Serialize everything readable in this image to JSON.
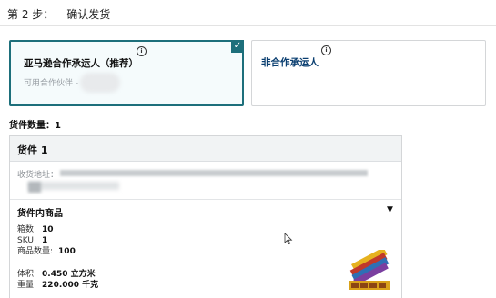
{
  "step": {
    "label": "第 2 步：",
    "title": "确认发货"
  },
  "carriers": [
    {
      "name": "亚马逊合作承运人（推荐）",
      "partner_label": "可用合作伙伴 -",
      "selected": true
    },
    {
      "name": "非合作承运人",
      "selected": false
    }
  ],
  "shipment_count": "货件数量：1",
  "shipment": {
    "title": "货件 1",
    "address_label": "收货地址：",
    "items_title": "货件内商品",
    "details": [
      {
        "label": "箱数:",
        "value": "10"
      },
      {
        "label": "SKU:",
        "value": "1"
      },
      {
        "label": "商品数量:",
        "value": "100"
      }
    ],
    "volume_label": "体积:",
    "volume_value": "0.450 立方米",
    "weight_label": "重量:",
    "weight_value": "220.000 千克"
  },
  "icons": [
    "info-icon",
    "checkmark-icon",
    "caret-down-icon",
    "mouse-cursor-icon"
  ],
  "colors": {
    "selected_border": "#1d6f7b",
    "link_blue": "#0a3e70",
    "header_bg": "#f1f3f4"
  }
}
